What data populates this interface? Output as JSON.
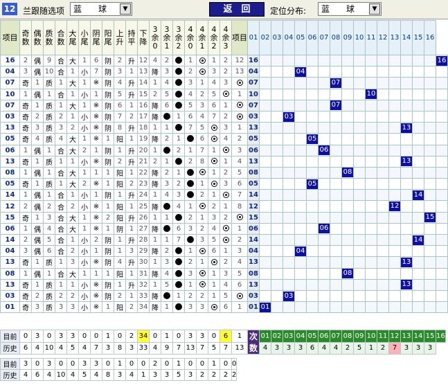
{
  "toolbar": {
    "period": "12",
    "follow_label": "兰跟随选项",
    "follow_value": "蓝　　球",
    "back_label": "返　回",
    "pos_label": "定位分布:",
    "pos_value": "蓝　　球"
  },
  "headers": [
    "项目",
    "奇数",
    "偶数",
    "质数",
    "合数",
    "大尾",
    "小尾",
    "阴尾",
    "阳尾",
    "上升",
    "持平",
    "下降",
    "3余0",
    "3余1",
    "3余2",
    "4余0",
    "4余1",
    "4余2",
    "4余3",
    "项目"
  ],
  "dist_headers": [
    "01",
    "02",
    "03",
    "04",
    "05",
    "06",
    "07",
    "08",
    "09",
    "10",
    "11",
    "12",
    "13",
    "14",
    "15",
    "16"
  ],
  "rows": [
    [
      "16",
      "2",
      "偶",
      "9",
      "合",
      "大",
      "1",
      "6",
      "阴",
      "2",
      "升",
      "12",
      "4",
      "2",
      "●",
      "1",
      "◎",
      "1",
      "2",
      "12",
      "16"
    ],
    [
      "04",
      "3",
      "偶",
      "10",
      "合",
      "1",
      "小",
      "7",
      "阴",
      "3",
      "1",
      "13",
      "降",
      "3",
      "●",
      "2",
      "◎",
      "3",
      "2",
      "13",
      "04"
    ],
    [
      "07",
      "奇",
      "1",
      "质",
      "1",
      "大",
      "1",
      "※",
      "阴",
      "4",
      "升",
      "14",
      "1",
      "4",
      "●",
      "3",
      "1",
      "4",
      "3",
      "◎",
      "07"
    ],
    [
      "10",
      "1",
      "偶",
      "1",
      "合",
      "1",
      "小",
      "1",
      "阴",
      "5",
      "升",
      "15",
      "2",
      "5",
      "●",
      "4",
      "2",
      "5",
      "◎",
      "1",
      "10"
    ],
    [
      "07",
      "奇",
      "1",
      "质",
      "1",
      "大",
      "1",
      "※",
      "阴",
      "6",
      "1",
      "16",
      "降",
      "6",
      "●",
      "5",
      "3",
      "6",
      "1",
      "◎",
      "07"
    ],
    [
      "03",
      "奇",
      "2",
      "质",
      "2",
      "1",
      "小",
      "※",
      "阴",
      "7",
      "2",
      "17",
      "降",
      "●",
      "1",
      "6",
      "4",
      "7",
      "2",
      "◎",
      "03"
    ],
    [
      "13",
      "奇",
      "3",
      "质",
      "3",
      "2",
      "小",
      "※",
      "阴",
      "8",
      "升",
      "18",
      "1",
      "1",
      "●",
      "7",
      "5",
      "◎",
      "3",
      "1",
      "13"
    ],
    [
      "05",
      "奇",
      "4",
      "质",
      "4",
      "大",
      "1",
      "※",
      "1",
      "阳",
      "1",
      "19",
      "降",
      "2",
      "1",
      "●",
      "6",
      "◎",
      "4",
      "2",
      "05"
    ],
    [
      "06",
      "1",
      "偶",
      "1",
      "合",
      "大",
      "2",
      "1",
      "阴",
      "1",
      "升",
      "20",
      "1",
      "●",
      "2",
      "1",
      "7",
      "1",
      "◎",
      "3",
      "06"
    ],
    [
      "13",
      "奇",
      "1",
      "质",
      "1",
      "1",
      "小",
      "※",
      "阴",
      "2",
      "升",
      "21",
      "2",
      "1",
      "●",
      "2",
      "8",
      "◎",
      "1",
      "4",
      "13"
    ],
    [
      "08",
      "1",
      "偶",
      "1",
      "合",
      "大",
      "1",
      "1",
      "1",
      "阳",
      "1",
      "22",
      "降",
      "2",
      "1",
      "●",
      "◎",
      "1",
      "2",
      "5",
      "08"
    ],
    [
      "05",
      "奇",
      "1",
      "质",
      "1",
      "大",
      "2",
      "※",
      "1",
      "阳",
      "2",
      "23",
      "降",
      "3",
      "2",
      "●",
      "1",
      "◎",
      "3",
      "6",
      "05"
    ],
    [
      "14",
      "1",
      "偶",
      "1",
      "合",
      "1",
      "小",
      "1",
      "阴",
      "1",
      "升",
      "24",
      "1",
      "4",
      "3",
      "●",
      "2",
      "1",
      "◎",
      "7",
      "14"
    ],
    [
      "12",
      "2",
      "偶",
      "2",
      "合",
      "2",
      "小",
      "※",
      "1",
      "阳",
      "1",
      "25",
      "降",
      "●",
      "4",
      "1",
      "◎",
      "2",
      "1",
      "8",
      "12"
    ],
    [
      "15",
      "奇",
      "1",
      "3",
      "合",
      "大",
      "1",
      "※",
      "2",
      "阳",
      "升",
      "26",
      "1",
      "1",
      "●",
      "2",
      "1",
      "3",
      "2",
      "◎",
      "15"
    ],
    [
      "06",
      "1",
      "偶",
      "4",
      "合",
      "大",
      "1",
      "※",
      "1",
      "阴",
      "1",
      "27",
      "降",
      "●",
      "6",
      "3",
      "2",
      "4",
      "◎",
      "1",
      "06"
    ],
    [
      "14",
      "2",
      "偶",
      "5",
      "合",
      "1",
      "小",
      "2",
      "阴",
      "1",
      "升",
      "28",
      "1",
      "1",
      "7",
      "●",
      "3",
      "5",
      "◎",
      "2",
      "14"
    ],
    [
      "04",
      "3",
      "偶",
      "6",
      "合",
      "2",
      "小",
      "1",
      "阴",
      "1",
      "3",
      "29",
      "降",
      "2",
      "●",
      "1",
      "◎",
      "6",
      "1",
      "3",
      "04"
    ],
    [
      "13",
      "奇",
      "1",
      "质",
      "1",
      "3",
      "小",
      "※",
      "阴",
      "4",
      "升",
      "30",
      "1",
      "3",
      "●",
      "2",
      "1",
      "◎",
      "2",
      "4",
      "13"
    ],
    [
      "08",
      "1",
      "偶",
      "1",
      "合",
      "大",
      "1",
      "1",
      "1",
      "阳",
      "1",
      "31",
      "降",
      "4",
      "●",
      "3",
      "◎",
      "1",
      "3",
      "5",
      "08"
    ],
    [
      "13",
      "奇",
      "1",
      "质",
      "1",
      "1",
      "小",
      "※",
      "阴",
      "1",
      "升",
      "32",
      "1",
      "5",
      "●",
      "1",
      "◎",
      "1",
      "4",
      "6",
      "13"
    ],
    [
      "03",
      "奇",
      "2",
      "质",
      "2",
      "2",
      "小",
      "※",
      "阴",
      "2",
      "1",
      "33",
      "降",
      "●",
      "1",
      "2",
      "2",
      "1",
      "5",
      "◎",
      "03"
    ],
    [
      "01",
      "奇",
      "3",
      "质",
      "3",
      "3",
      "小",
      "※",
      "1",
      "阳",
      "2",
      "34",
      "降",
      "1",
      "●",
      "3",
      "3",
      "◎",
      "6",
      "1",
      "01"
    ]
  ],
  "stats": {
    "current_label": "目前",
    "history_label": "历史",
    "current": [
      "0",
      "3",
      "0",
      "3",
      "3",
      "0",
      "0",
      "1",
      "0",
      "2",
      "34",
      "0",
      "1",
      "0",
      "3",
      "3",
      "0",
      "6",
      "1"
    ],
    "history": [
      "6",
      "4",
      "10",
      "4",
      "5",
      "4",
      "7",
      "3",
      "8",
      "3",
      "33",
      "4",
      "9",
      "7",
      "13",
      "7",
      "5",
      "7",
      "13"
    ],
    "count_label": "次数",
    "count_values": [
      "4",
      "3",
      "3",
      "3",
      "6",
      "4",
      "4",
      "2",
      "5",
      "1",
      "2",
      "7",
      "3",
      "3",
      "3"
    ],
    "current2": [
      "3",
      "0",
      "3",
      "0",
      "0",
      "3",
      "3",
      "0",
      "1",
      "0",
      "0",
      "2",
      "0",
      "1",
      "0",
      "0",
      "1",
      "0",
      "0"
    ],
    "history2": [
      "4",
      "6",
      "4",
      "10",
      "4",
      "5",
      "4",
      "8",
      "3",
      "4",
      "1",
      "3",
      "3",
      "5",
      "3",
      "2",
      "2",
      "2",
      "2"
    ]
  },
  "colors": {
    "accent": "#1010a0",
    "highlight": "#ffff33",
    "pink": "#ffb0b8"
  }
}
